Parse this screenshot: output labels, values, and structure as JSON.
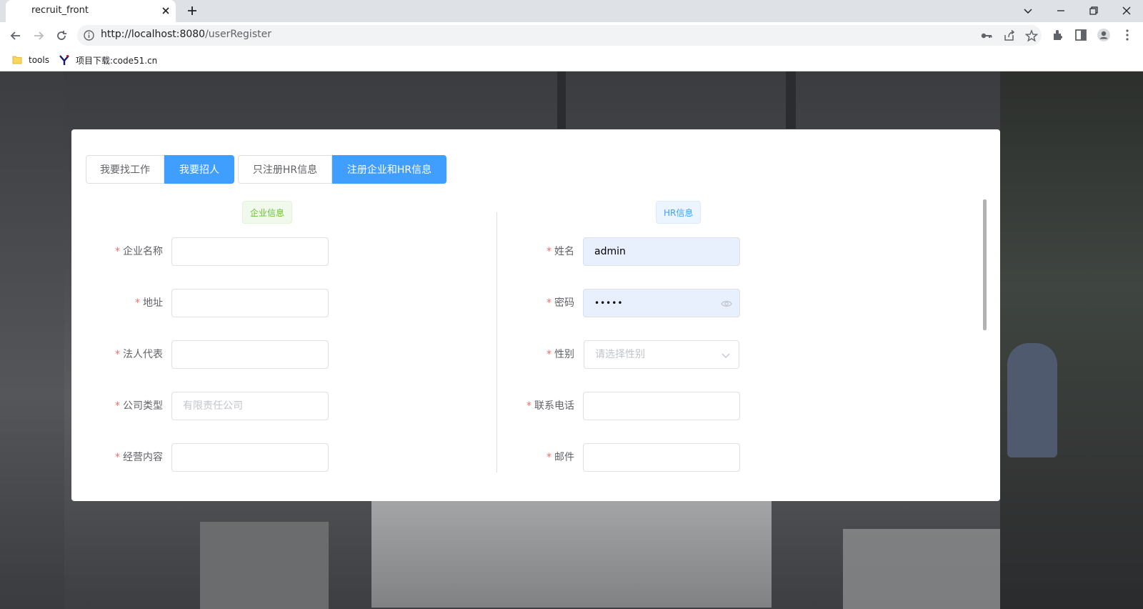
{
  "browser": {
    "tab_title": "recruit_front",
    "url_host": "http://localhost:8080",
    "url_path": "/userRegister",
    "bookmarks": [
      {
        "label": "tools",
        "icon": "folder-icon"
      },
      {
        "label": "项目下载:code51.cn",
        "icon": "y-logo-icon"
      }
    ]
  },
  "mode_tabs": [
    {
      "label": "我要找工作",
      "active": false
    },
    {
      "label": "我要招人",
      "active": true
    }
  ],
  "register_tabs": [
    {
      "label": "只注册HR信息",
      "active": false
    },
    {
      "label": "注册企业和HR信息",
      "active": true
    }
  ],
  "company": {
    "title": "企业信息",
    "fields": [
      {
        "label": "企业名称",
        "required": true,
        "value": "",
        "placeholder": ""
      },
      {
        "label": "地址",
        "required": true,
        "value": "",
        "placeholder": ""
      },
      {
        "label": "法人代表",
        "required": true,
        "value": "",
        "placeholder": ""
      },
      {
        "label": "公司类型",
        "required": true,
        "value": "",
        "placeholder": "有限责任公司"
      },
      {
        "label": "经营内容",
        "required": true,
        "value": "",
        "placeholder": ""
      }
    ]
  },
  "hr": {
    "title": "HR信息",
    "name": {
      "label": "姓名",
      "value": "admin"
    },
    "password": {
      "label": "密码",
      "masked": "•••••",
      "icon": "eye-icon"
    },
    "gender": {
      "label": "性别",
      "placeholder": "请选择性别",
      "icon": "chevron-down-icon"
    },
    "phone": {
      "label": "联系电话",
      "value": ""
    },
    "email": {
      "label": "邮件",
      "value": ""
    }
  },
  "colors": {
    "primary": "#409eff",
    "required": "#f56c6c",
    "success_tag": "#67c23a",
    "autofill": "#e8f0fe"
  }
}
